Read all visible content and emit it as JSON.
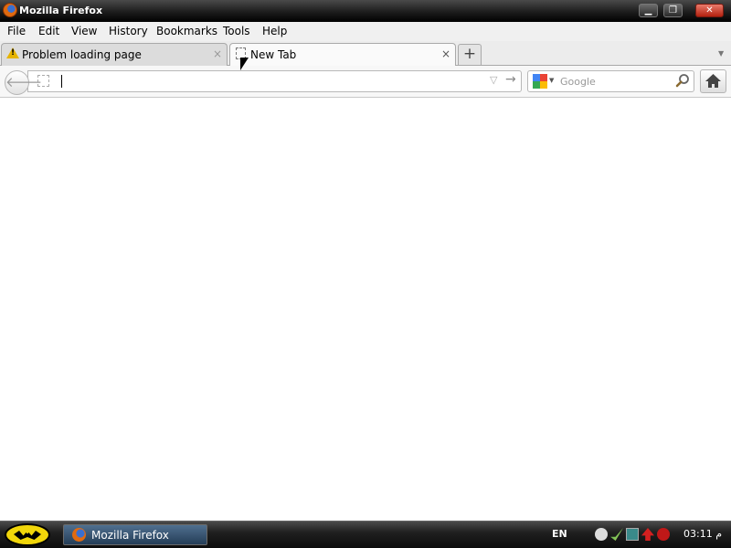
{
  "window": {
    "title": "Mozilla Firefox"
  },
  "menu": {
    "items": [
      "File",
      "Edit",
      "View",
      "History",
      "Bookmarks",
      "Tools",
      "Help"
    ]
  },
  "tabs": [
    {
      "label": "Problem loading page",
      "icon": "warning-icon",
      "active": false
    },
    {
      "label": "New Tab",
      "icon": "blank-page-icon",
      "active": true
    }
  ],
  "tabbar": {
    "new_tab_glyph": "+",
    "close_glyph": "×"
  },
  "navbar": {
    "url_value": "",
    "search_placeholder": "Google",
    "search_engine": "google-icon"
  },
  "taskbar": {
    "start_icon": "batman-logo-icon",
    "task_label": "Mozilla Firefox",
    "language": "EN",
    "clock": "03:11 م"
  },
  "colors": {
    "titlebar": "#1c1c1c",
    "close_button": "#c8321e",
    "taskbar_button": "#2e4a66",
    "start_button": "#f1d60a"
  }
}
